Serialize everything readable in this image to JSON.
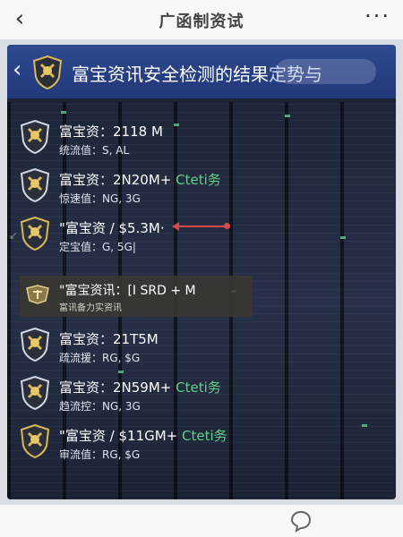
{
  "topbar": {
    "back_icon": "‹",
    "title": "广函制资试",
    "more_icon": "···"
  },
  "banner": {
    "back_icon": "‹",
    "title": "富宝资讯安全检测的结果",
    "title_tail": "定势与"
  },
  "side_mark": "↙",
  "items": [
    {
      "title": "富宝资：2118 M",
      "tag": "",
      "sub": "统流值：S, AL"
    },
    {
      "title": "富宝资：2N20M+",
      "tag": "Cteti务",
      "sub": "惊速值：NG, 3G"
    },
    {
      "title": "\"富宝资 / $5.3M·",
      "tag": "",
      "sub": "定宝值：G, 5G|"
    },
    {
      "title": "富宝资：21T5M",
      "tag": "",
      "sub": "疏流援：RG, $G"
    },
    {
      "title": "富宝资：2N59M+",
      "tag": "Cteti务",
      "sub": "趋流控：NG, 3G"
    },
    {
      "title": "\"富宝资 / $11GM+",
      "tag": "Cteti务",
      "sub": "审流值：RG, $G"
    }
  ],
  "highlight": {
    "title": "\"富宝资讯：[I  SRD + M",
    "sub": "富讯备力实资讯"
  },
  "colors": {
    "banner": "#2a4588",
    "panel": "#1b2233",
    "tag_green": "#5fd08a",
    "arrow_red": "#d64a4a"
  }
}
